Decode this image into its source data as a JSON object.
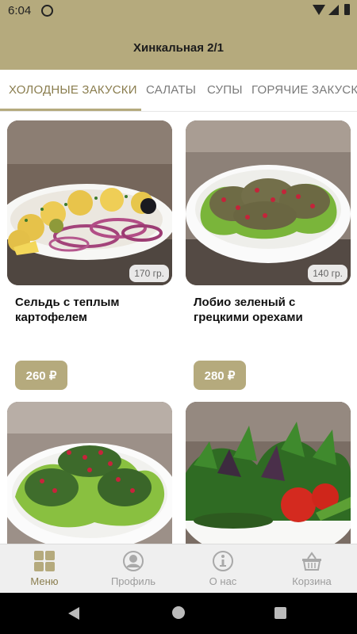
{
  "status": {
    "time": "6:04"
  },
  "header": {
    "title": "Хинкальная 2/1"
  },
  "tabs": [
    {
      "label": "ХОЛОДНЫЕ ЗАКУСКИ",
      "active": true
    },
    {
      "label": "САЛАТЫ",
      "active": false
    },
    {
      "label": "СУПЫ",
      "active": false
    },
    {
      "label": "ГОРЯЧИЕ ЗАКУСКИ",
      "active": false
    }
  ],
  "products": [
    {
      "name": "Сельдь с теплым картофелем",
      "weight": "170 гр.",
      "price": "260 ₽"
    },
    {
      "name": "Лобио зеленый с грецкими орехами",
      "weight": "140 гр.",
      "price": "280 ₽"
    },
    {
      "name": "",
      "weight": "",
      "price": ""
    },
    {
      "name": "",
      "weight": "",
      "price": ""
    }
  ],
  "nav": [
    {
      "label": "Меню",
      "icon": "menu-grid-icon",
      "active": true
    },
    {
      "label": "Профиль",
      "icon": "profile-icon",
      "active": false
    },
    {
      "label": "О нас",
      "icon": "info-icon",
      "active": false
    },
    {
      "label": "Корзина",
      "icon": "basket-icon",
      "active": false
    }
  ],
  "colors": {
    "accent": "#b5aa7d",
    "accent_dark": "#8a7d4e"
  }
}
